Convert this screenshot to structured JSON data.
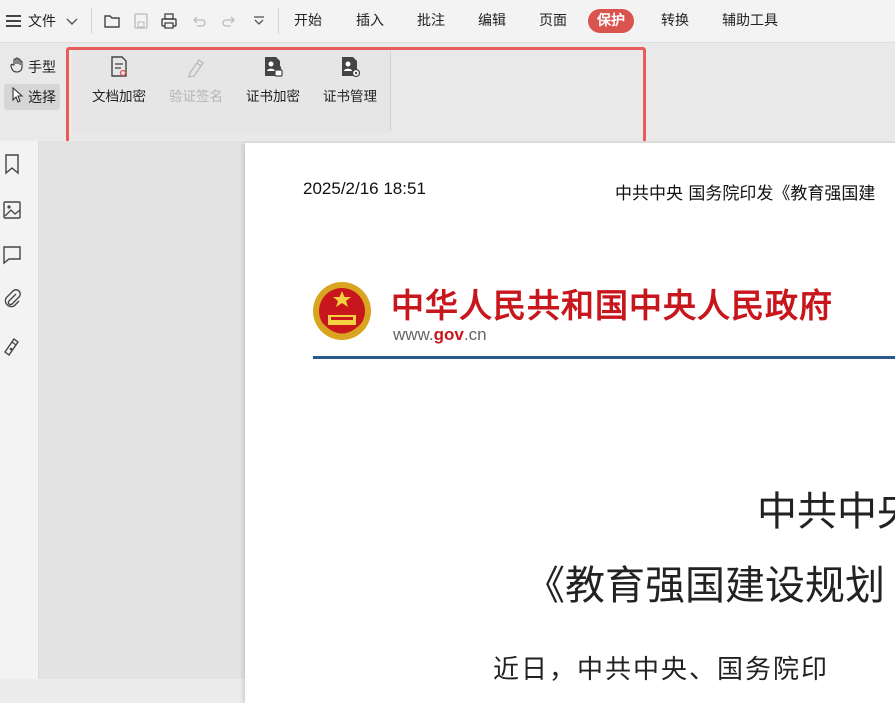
{
  "menubar": {
    "file_label": "文件",
    "tabs": [
      {
        "label": "开始"
      },
      {
        "label": "插入"
      },
      {
        "label": "批注"
      },
      {
        "label": "编辑"
      },
      {
        "label": "页面"
      },
      {
        "label": "保护",
        "active": true
      },
      {
        "label": "转换"
      },
      {
        "label": "辅助工具"
      }
    ],
    "quick_access": [
      "open-folder-icon",
      "save-icon",
      "print-icon",
      "undo-icon",
      "redo-icon",
      "more-chevron-icon"
    ]
  },
  "ribbon": {
    "modes": [
      {
        "label": "手型",
        "icon": "hand-icon"
      },
      {
        "label": "选择",
        "icon": "cursor-icon",
        "selected": true
      }
    ],
    "buttons": [
      {
        "label": "文档加密",
        "icon": "doc-encrypt-icon",
        "enabled": true
      },
      {
        "label": "验证签名",
        "icon": "verify-signature-icon",
        "enabled": false
      },
      {
        "label": "证书加密",
        "icon": "cert-encrypt-icon",
        "enabled": true
      },
      {
        "label": "证书管理",
        "icon": "cert-manage-icon",
        "enabled": true
      }
    ]
  },
  "sidebar": {
    "icons": [
      "bookmark-icon",
      "image-icon",
      "comment-icon",
      "attachment-icon",
      "signature-icon"
    ]
  },
  "document": {
    "date": "2025/2/16 18:51",
    "header_text": "中共中央 国务院印发《教育强国建",
    "site_name": "中华人民共和国中央人民政府",
    "url_prefix": "www.",
    "url_gov": "gov",
    "url_suffix": ".cn",
    "title_line1": "中共中央",
    "title_line2": "《教育强国建设规划",
    "para_start": "近日，中共中央、国务院印"
  },
  "colors": {
    "active_tab": "#d9534f",
    "highlight_box": "#e85c5c",
    "gov_red": "#c8161d",
    "rule_blue": "#2c5a8c"
  }
}
